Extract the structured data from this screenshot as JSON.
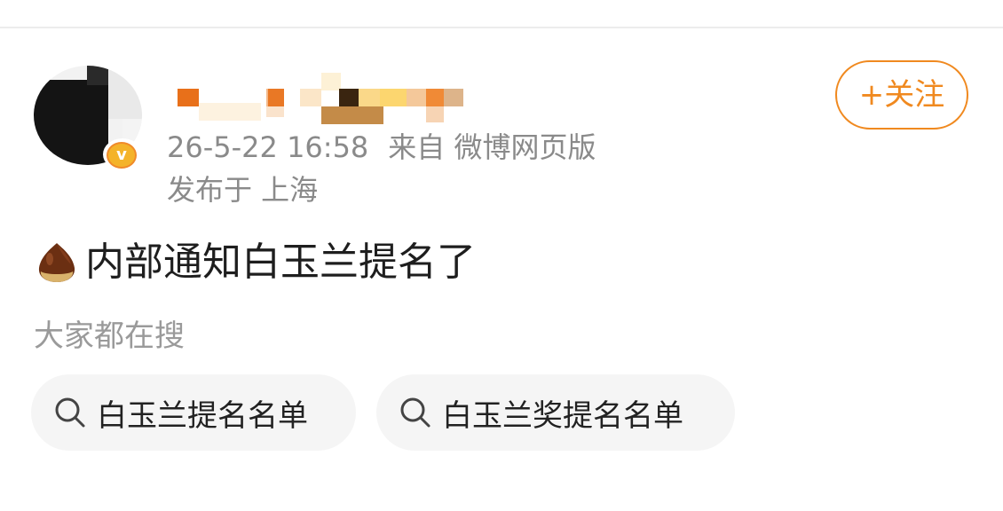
{
  "post": {
    "timestamp": "26-5-22 16:58",
    "source": "来自 微博网页版",
    "location": "发布于 上海",
    "text": "内部通知白玉兰提名了",
    "emoji": "chestnut-icon"
  },
  "follow": {
    "label": "+关注"
  },
  "search": {
    "heading": "大家都在搜",
    "chips": [
      {
        "label": "白玉兰提名名单",
        "icon": "search-icon"
      },
      {
        "label": "白玉兰奖提名名单",
        "icon": "search-icon"
      }
    ]
  },
  "colors": {
    "accent": "#f0891f",
    "meta_text": "#8a8a8a",
    "chip_bg": "#f5f5f5",
    "verified": "#f4b32a"
  }
}
